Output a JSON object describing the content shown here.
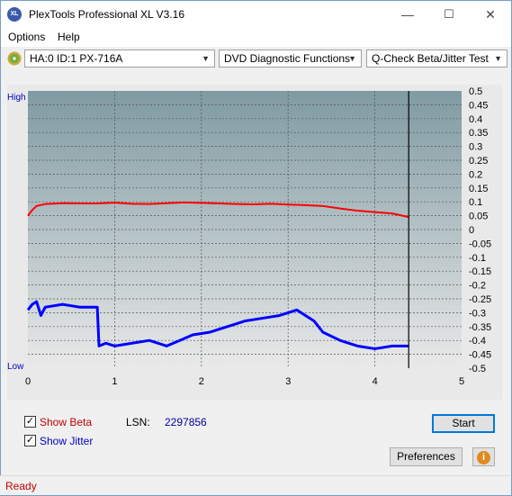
{
  "window": {
    "title": "PlexTools Professional XL V3.16",
    "app_icon_text": "XL",
    "minimize": "—",
    "maximize": "☐",
    "close": "✕"
  },
  "menu": {
    "options_label": "Options",
    "help_label": "Help"
  },
  "toolbar": {
    "drive": "HA:0 ID:1  PX-716A",
    "function": "DVD Diagnostic Functions",
    "test": "Q-Check Beta/Jitter Test"
  },
  "chart_labels": {
    "high": "High",
    "low": "Low"
  },
  "chart_data": {
    "type": "line",
    "x_ticks": [
      "0",
      "1",
      "2",
      "3",
      "4",
      "5"
    ],
    "xlim": [
      0,
      5
    ],
    "y_ticks": [
      "0.5",
      "0.45",
      "0.4",
      "0.35",
      "0.3",
      "0.25",
      "0.2",
      "0.15",
      "0.1",
      "0.05",
      "0",
      "-0.05",
      "-0.1",
      "-0.15",
      "-0.2",
      "-0.25",
      "-0.3",
      "-0.35",
      "-0.4",
      "-0.45",
      "-0.5"
    ],
    "ylim": [
      -0.5,
      0.5
    ],
    "end_marker_x": 4.39,
    "grid": true,
    "series": [
      {
        "color": "#ff0000",
        "x": [
          0,
          0.05,
          0.1,
          0.2,
          0.4,
          0.6,
          0.8,
          1.0,
          1.2,
          1.4,
          1.6,
          1.8,
          2.0,
          2.2,
          2.4,
          2.6,
          2.8,
          3.0,
          3.2,
          3.4,
          3.6,
          3.8,
          4.0,
          4.2,
          4.39
        ],
        "y": [
          0.05,
          0.07,
          0.085,
          0.092,
          0.095,
          0.094,
          0.094,
          0.097,
          0.093,
          0.092,
          0.095,
          0.098,
          0.096,
          0.094,
          0.092,
          0.091,
          0.093,
          0.09,
          0.088,
          0.085,
          0.076,
          0.068,
          0.063,
          0.058,
          0.045
        ]
      },
      {
        "color": "#0000ff",
        "x": [
          0,
          0.05,
          0.1,
          0.15,
          0.2,
          0.3,
          0.4,
          0.5,
          0.6,
          0.7,
          0.8,
          0.82,
          0.9,
          1.0,
          1.2,
          1.4,
          1.6,
          1.75,
          1.9,
          2.1,
          2.3,
          2.5,
          2.7,
          2.9,
          3.0,
          3.1,
          3.2,
          3.3,
          3.4,
          3.6,
          3.8,
          4.0,
          4.2,
          4.39
        ],
        "y": [
          -0.29,
          -0.27,
          -0.26,
          -0.31,
          -0.28,
          -0.275,
          -0.27,
          -0.275,
          -0.28,
          -0.28,
          -0.28,
          -0.42,
          -0.41,
          -0.42,
          -0.41,
          -0.4,
          -0.42,
          -0.4,
          -0.38,
          -0.37,
          -0.35,
          -0.33,
          -0.32,
          -0.31,
          -0.3,
          -0.29,
          -0.31,
          -0.33,
          -0.37,
          -0.4,
          -0.42,
          -0.43,
          -0.42,
          -0.42
        ]
      }
    ]
  },
  "controls": {
    "show_beta": {
      "label": "Show Beta",
      "checked": "✓"
    },
    "show_jitter": {
      "label": "Show Jitter",
      "checked": "✓"
    },
    "lsn_label": "LSN:",
    "lsn_value": "2297856",
    "start_label": "Start",
    "preferences_label": "Preferences",
    "info_icon": "i"
  },
  "status": {
    "text": "Ready"
  },
  "colors": {
    "beta": "#ff0000",
    "jitter": "#0000ff",
    "plot_top": "#7f9aa2",
    "plot_bottom": "#e9e9e9"
  }
}
